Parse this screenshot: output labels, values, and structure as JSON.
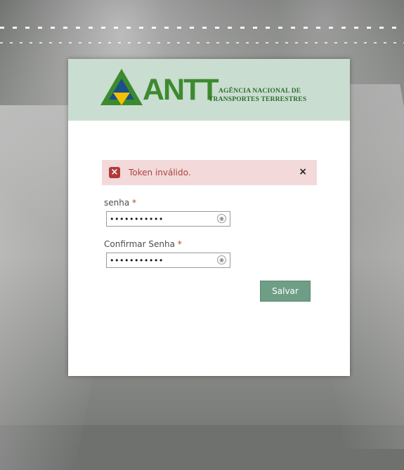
{
  "brand": {
    "logo_word": "ANTT",
    "agency_line1": "AGÊNCIA NACIONAL DE",
    "agency_line2": "TRANSPORTES TERRESTRES",
    "colors": {
      "green": "#3d8a2e",
      "blue": "#1b4f8a",
      "yellow": "#f2c200",
      "header_bg": "#c9ddd1"
    }
  },
  "alert": {
    "message": "Token inválido.",
    "close_symbol": "×",
    "icon": "error-x-icon"
  },
  "form": {
    "password": {
      "label": "senha",
      "required_mark": "*",
      "value_masked": "•••••••••••"
    },
    "confirm_password": {
      "label": "Confirmar Senha",
      "required_mark": "*",
      "value_masked": "•••••••••••"
    },
    "reveal_icon": "eye-icon",
    "save_label": "Salvar"
  }
}
